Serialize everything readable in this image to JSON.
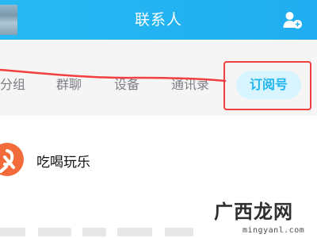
{
  "header": {
    "title": "联系人",
    "add_contact_icon": "add-contact-icon"
  },
  "tabs": [
    {
      "label": "分组"
    },
    {
      "label": "群聊"
    },
    {
      "label": "设备"
    },
    {
      "label": "通讯录"
    },
    {
      "label": "订阅号",
      "selected": true
    }
  ],
  "list": {
    "items": [
      {
        "title": "吃喝玩乐"
      }
    ]
  },
  "watermark": {
    "brand": "广西龙网",
    "url": "mingyanl.com"
  },
  "colors": {
    "header_bg": "#20aef0",
    "selected_tab_text": "#1eb5ef",
    "selected_tab_bg": "#d7f4ff",
    "annotation_red": "#f23f3f",
    "item_avatar": "#f36b3a"
  }
}
